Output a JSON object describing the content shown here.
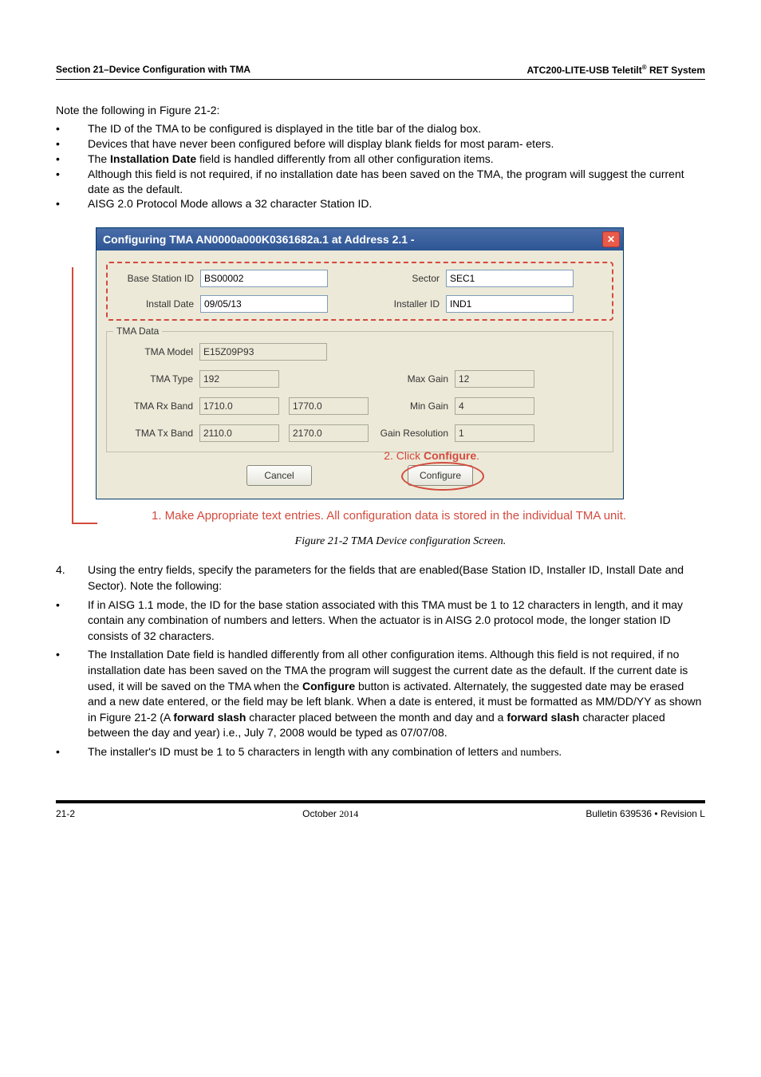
{
  "header": {
    "left": "Section 21–Device Configuration with TMA",
    "right_pre": "ATC200-LITE-USB Teletilt",
    "right_sup": "®",
    "right_post": " RET System"
  },
  "intro": "Note the following in Figure 21-2:",
  "notes": [
    "The ID of the TMA to be configured is displayed in the title bar of the dialog box.",
    "Devices that have never been configured before will display blank fields for most param- eters.",
    "The Installation Date field is handled differently from all other configuration items.",
    "Although this field is not required, if no installation date has been saved on the TMA, the program will suggest the current date as the default.",
    "AISG 2.0 Protocol Mode allows a 32 character Station ID."
  ],
  "dialog": {
    "title": "Configuring TMA AN0000a000K0361682a.1 at Address 2.1 -",
    "fields": {
      "base_station_id_label": "Base Station ID",
      "base_station_id": "BS00002",
      "sector_label": "Sector",
      "sector": "SEC1",
      "install_date_label": "Install Date",
      "install_date": "09/05/13",
      "installer_id_label": "Installer ID",
      "installer_id": "IND1"
    },
    "tma_legend": "TMA Data",
    "tma": {
      "model_label": "TMA Model",
      "model": "E15Z09P93",
      "type_label": "TMA Type",
      "type": "192",
      "max_gain_label": "Max Gain",
      "max_gain": "12",
      "rx_band_label": "TMA Rx Band",
      "rx_lo": "1710.0",
      "rx_hi": "1770.0",
      "min_gain_label": "Min Gain",
      "min_gain": "4",
      "tx_band_label": "TMA Tx Band",
      "tx_lo": "2110.0",
      "tx_hi": "2170.0",
      "gain_res_label": "Gain Resolution",
      "gain_res": "1"
    },
    "buttons": {
      "cancel": "Cancel",
      "configure": "Configure"
    }
  },
  "callouts": {
    "c1": "1. Make Appropriate text entries.  All configuration data is stored in the individual TMA unit.",
    "c2_pre": "2. Click ",
    "c2_bold": "Configure",
    "c2_post": "."
  },
  "figcap": "Figure 21-2 TMA Device configuration Screen.",
  "step4": {
    "num": "4.",
    "text": "Using the entry fields, specify the parameters for the fields that are enabled(Base Station ID, Installer ID, Install Date and Sector). Note the following:"
  },
  "subs": [
    "If in AISG 1.1 mode, the ID for the base station associated with this TMA must be 1 to 12 characters in length, and it may contain any combination of numbers and letters. When the actuator is in AISG 2.0 protocol mode, the longer station ID consists of 32 characters.",
    "The Installation Date field is handled differently from all other configuration items. Although this field is not required, if no installation date has been saved on the TMA the program will suggest the current date as the default. If the current date is used, it will be saved on the TMA when the Configure button is activated. Alternately, the suggested date may be erased and a new date entered, or the field may be left blank. When a date is entered, it must be formatted as MM/DD/YY as shown in Figure 21-2 (A forward slash character placed between the month and day and a forward slash character placed between the day and year) i.e., July 7, 2008 would be typed as 07/07/08.",
    "The installer's ID must be 1 to 5 characters in length with any combination of letters and numbers."
  ],
  "footer": {
    "left": "21-2",
    "mid_pre": "October ",
    "mid_year": "2014",
    "right": "Bulletin 639536  •  Revision L"
  },
  "chart_data": {
    "type": "table",
    "title": "TMA Device configuration fields",
    "rows": [
      {
        "field": "Base Station ID",
        "value": "BS00002"
      },
      {
        "field": "Sector",
        "value": "SEC1"
      },
      {
        "field": "Install Date",
        "value": "09/05/13"
      },
      {
        "field": "Installer ID",
        "value": "IND1"
      },
      {
        "field": "TMA Model",
        "value": "E15Z09P93"
      },
      {
        "field": "TMA Type",
        "value": "192"
      },
      {
        "field": "Max Gain",
        "value": 12
      },
      {
        "field": "TMA Rx Band low",
        "value": 1710.0
      },
      {
        "field": "TMA Rx Band high",
        "value": 1770.0
      },
      {
        "field": "Min Gain",
        "value": 4
      },
      {
        "field": "TMA Tx Band low",
        "value": 2110.0
      },
      {
        "field": "TMA Tx Band high",
        "value": 2170.0
      },
      {
        "field": "Gain Resolution",
        "value": 1
      }
    ]
  }
}
